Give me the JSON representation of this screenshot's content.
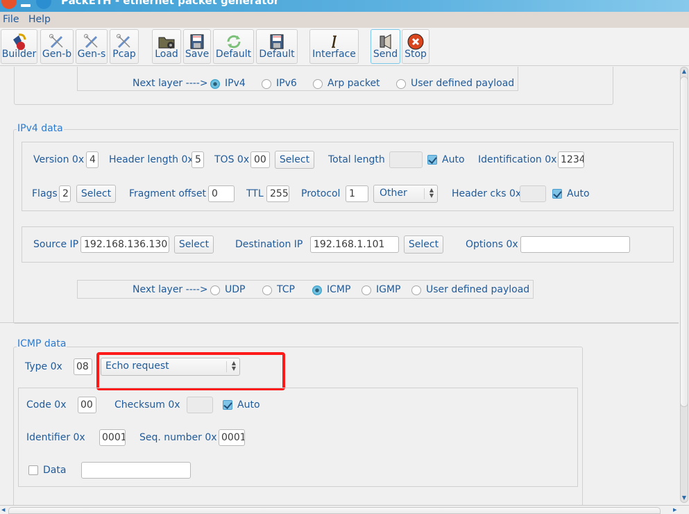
{
  "window": {
    "title": "PackETH - ethernet packet generator"
  },
  "menu": {
    "items": [
      "File",
      "Help"
    ]
  },
  "toolbar": {
    "buttons": [
      {
        "label": "Builder",
        "icon": "builder-icon"
      },
      {
        "label": "Gen-b",
        "icon": "tools-icon"
      },
      {
        "label": "Gen-s",
        "icon": "tools-icon"
      },
      {
        "label": "Pcap",
        "icon": "tools-icon"
      },
      {
        "label": "Load",
        "icon": "folder-gear-icon"
      },
      {
        "label": "Save",
        "icon": "floppy-icon"
      },
      {
        "label": "Default",
        "icon": "refresh-icon"
      },
      {
        "label": "Default",
        "icon": "floppy-icon"
      },
      {
        "label": "Interface",
        "icon": "interface-icon"
      },
      {
        "label": "Send",
        "icon": "speaker-icon"
      },
      {
        "label": "Stop",
        "icon": "stop-icon"
      }
    ],
    "active": "Send"
  },
  "ethernet_next_layer": {
    "label": "Next layer  ---->",
    "options": [
      "IPv4",
      "IPv6",
      "Arp packet",
      "User defined payload"
    ],
    "selected": "IPv4"
  },
  "ipv4": {
    "title": "IPv4 data",
    "version_label": "Version 0x",
    "version": "4",
    "header_length_label": "Header length 0x",
    "header_length": "5",
    "tos_label": "TOS 0x",
    "tos": "00",
    "tos_select": "Select",
    "total_length_label": "Total length",
    "total_length": "",
    "total_length_auto": "Auto",
    "total_length_auto_checked": true,
    "identification_label": "Identification 0x",
    "identification": "1234",
    "flags_label": "Flags",
    "flags": "2",
    "flags_select": "Select",
    "fragment_offset_label": "Fragment offset",
    "fragment_offset": "0",
    "ttl_label": "TTL",
    "ttl": "255",
    "protocol_label": "Protocol",
    "protocol": "1",
    "protocol_combo": "Other",
    "header_cks_label": "Header cks 0x",
    "header_cks": "",
    "header_cks_auto": "Auto",
    "header_cks_auto_checked": true,
    "source_ip_label": "Source IP",
    "source_ip": "192.168.136.130",
    "source_select": "Select",
    "dest_ip_label": "Destination IP",
    "dest_ip": "192.168.1.101",
    "dest_select": "Select",
    "options_label": "Options 0x",
    "options": ""
  },
  "ip_next_layer": {
    "label": "Next layer  ---->",
    "options": [
      "UDP",
      "TCP",
      "ICMP",
      "IGMP",
      "User defined payload"
    ],
    "selected": "ICMP"
  },
  "icmp": {
    "title": "ICMP data",
    "type_label": "Type  0x",
    "type": "08",
    "type_combo": "Echo request",
    "code_label": "Code   0x",
    "code": "00",
    "checksum_label": "Checksum   0x",
    "checksum": "",
    "checksum_auto": "Auto",
    "checksum_auto_checked": true,
    "identifier_label": "Identifier    0x",
    "identifier": "0001",
    "seq_label": "Seq. number   0x",
    "seq": "0001",
    "data_label": "Data",
    "data_checked": false,
    "data": ""
  },
  "colors": {
    "accent": "#2a7bd0",
    "label": "#1f5a9a",
    "highlight": "#ff1a1a",
    "titlebar": "#4ea8da"
  }
}
